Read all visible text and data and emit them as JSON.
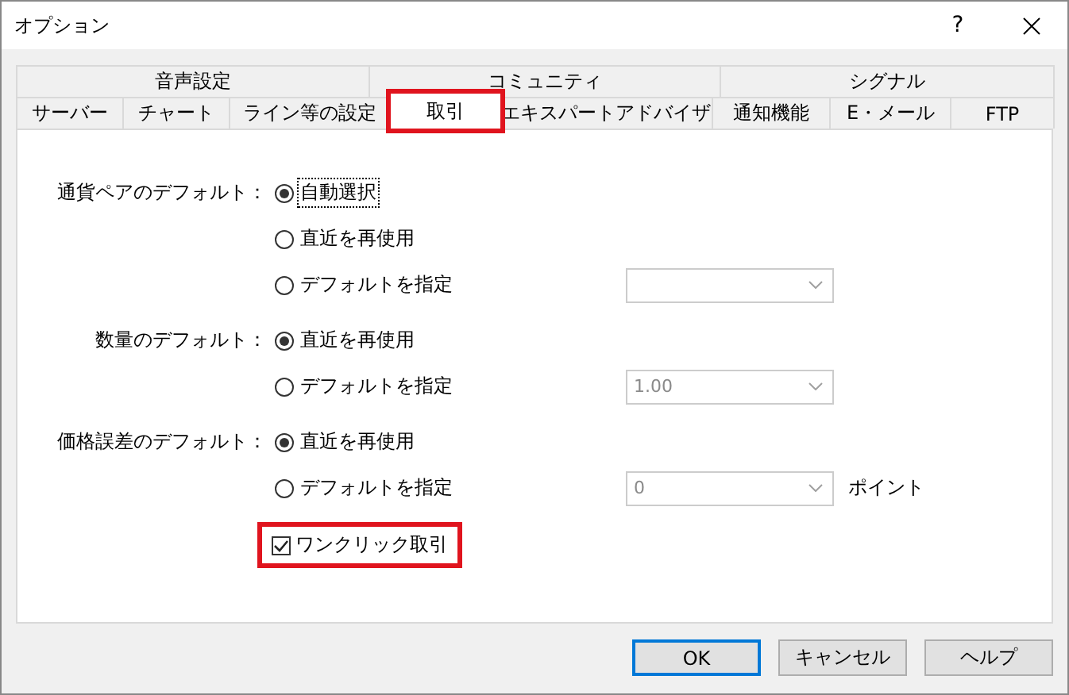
{
  "window": {
    "title": "オプション",
    "help": "?"
  },
  "tab_rows": [
    [
      {
        "label": "音声設定",
        "selected": false,
        "highlighted": false
      },
      {
        "label": "コミュニティ",
        "selected": false,
        "highlighted": false
      },
      {
        "label": "シグナル",
        "selected": false,
        "highlighted": false
      }
    ],
    [
      {
        "label": "サーバー",
        "selected": false,
        "highlighted": false
      },
      {
        "label": "チャート",
        "selected": false,
        "highlighted": false
      },
      {
        "label": "ライン等の設定",
        "selected": false,
        "highlighted": false
      },
      {
        "label": "取引",
        "selected": true,
        "highlighted": true
      },
      {
        "label": "エキスパートアドバイザ",
        "selected": false,
        "highlighted": false
      },
      {
        "label": "通知機能",
        "selected": false,
        "highlighted": false
      },
      {
        "label": "E・メール",
        "selected": false,
        "highlighted": false
      },
      {
        "label": "FTP",
        "selected": false,
        "highlighted": false
      }
    ]
  ],
  "sections": [
    {
      "label": "通貨ペアのデフォルト：",
      "options": [
        {
          "label": "自動選択",
          "selected": true,
          "focused": true
        },
        {
          "label": "直近を再使用",
          "selected": false
        },
        {
          "label": "デフォルトを指定",
          "selected": false,
          "dropdown": {
            "disabled": true
          }
        }
      ]
    },
    {
      "label": "数量のデフォルト：",
      "options": [
        {
          "label": "直近を再使用",
          "selected": true
        },
        {
          "label": "デフォルトを指定",
          "selected": false,
          "dropdown": {
            "value": "1.00",
            "disabled": true
          }
        }
      ]
    },
    {
      "label": "価格誤差のデフォルト：",
      "options": [
        {
          "label": "直近を再使用",
          "selected": true
        },
        {
          "label": "デフォルトを指定",
          "selected": false,
          "dropdown": {
            "value": "0",
            "disabled": true
          },
          "unit": "ポイント"
        }
      ]
    }
  ],
  "checkbox": {
    "label": "ワンクリック取引",
    "checked": true,
    "highlighted": true
  },
  "buttons": [
    {
      "label": "OK",
      "default": true
    },
    {
      "label": "キャンセル",
      "default": false
    },
    {
      "label": "ヘルプ",
      "default": false
    }
  ]
}
